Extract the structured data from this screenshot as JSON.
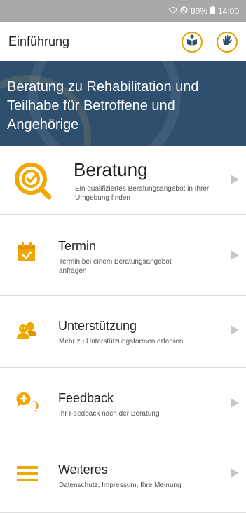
{
  "status": {
    "battery": "80%",
    "time": "14:00"
  },
  "header": {
    "title": "Einführung"
  },
  "hero": {
    "text": "Beratung zu Rehabilitation und Teilhabe für Betroffene und Angehörige"
  },
  "items": [
    {
      "title": "Beratung",
      "subtitle": "Ein qualifiziertes Beratungsangebot in Ihrer Umgebung finden",
      "icon": "search-check-icon"
    },
    {
      "title": "Termin",
      "subtitle": "Termin bei einem Beratungsangebot anfragen",
      "icon": "calendar-icon"
    },
    {
      "title": "Unterstützung",
      "subtitle": "Mehr zu Unterstützungsformen erfahren",
      "icon": "people-icon"
    },
    {
      "title": "Feedback",
      "subtitle": "Ihr Feedback nach der Beratung",
      "icon": "chat-plus-icon"
    },
    {
      "title": "Weiteres",
      "subtitle": "Datenschutz, Impressum, Ihre Meinung",
      "icon": "menu-icon"
    }
  ],
  "colors": {
    "accent": "#f0a800",
    "hero_bg": "#2e4f6e",
    "status_bg": "#a9a9a9"
  }
}
